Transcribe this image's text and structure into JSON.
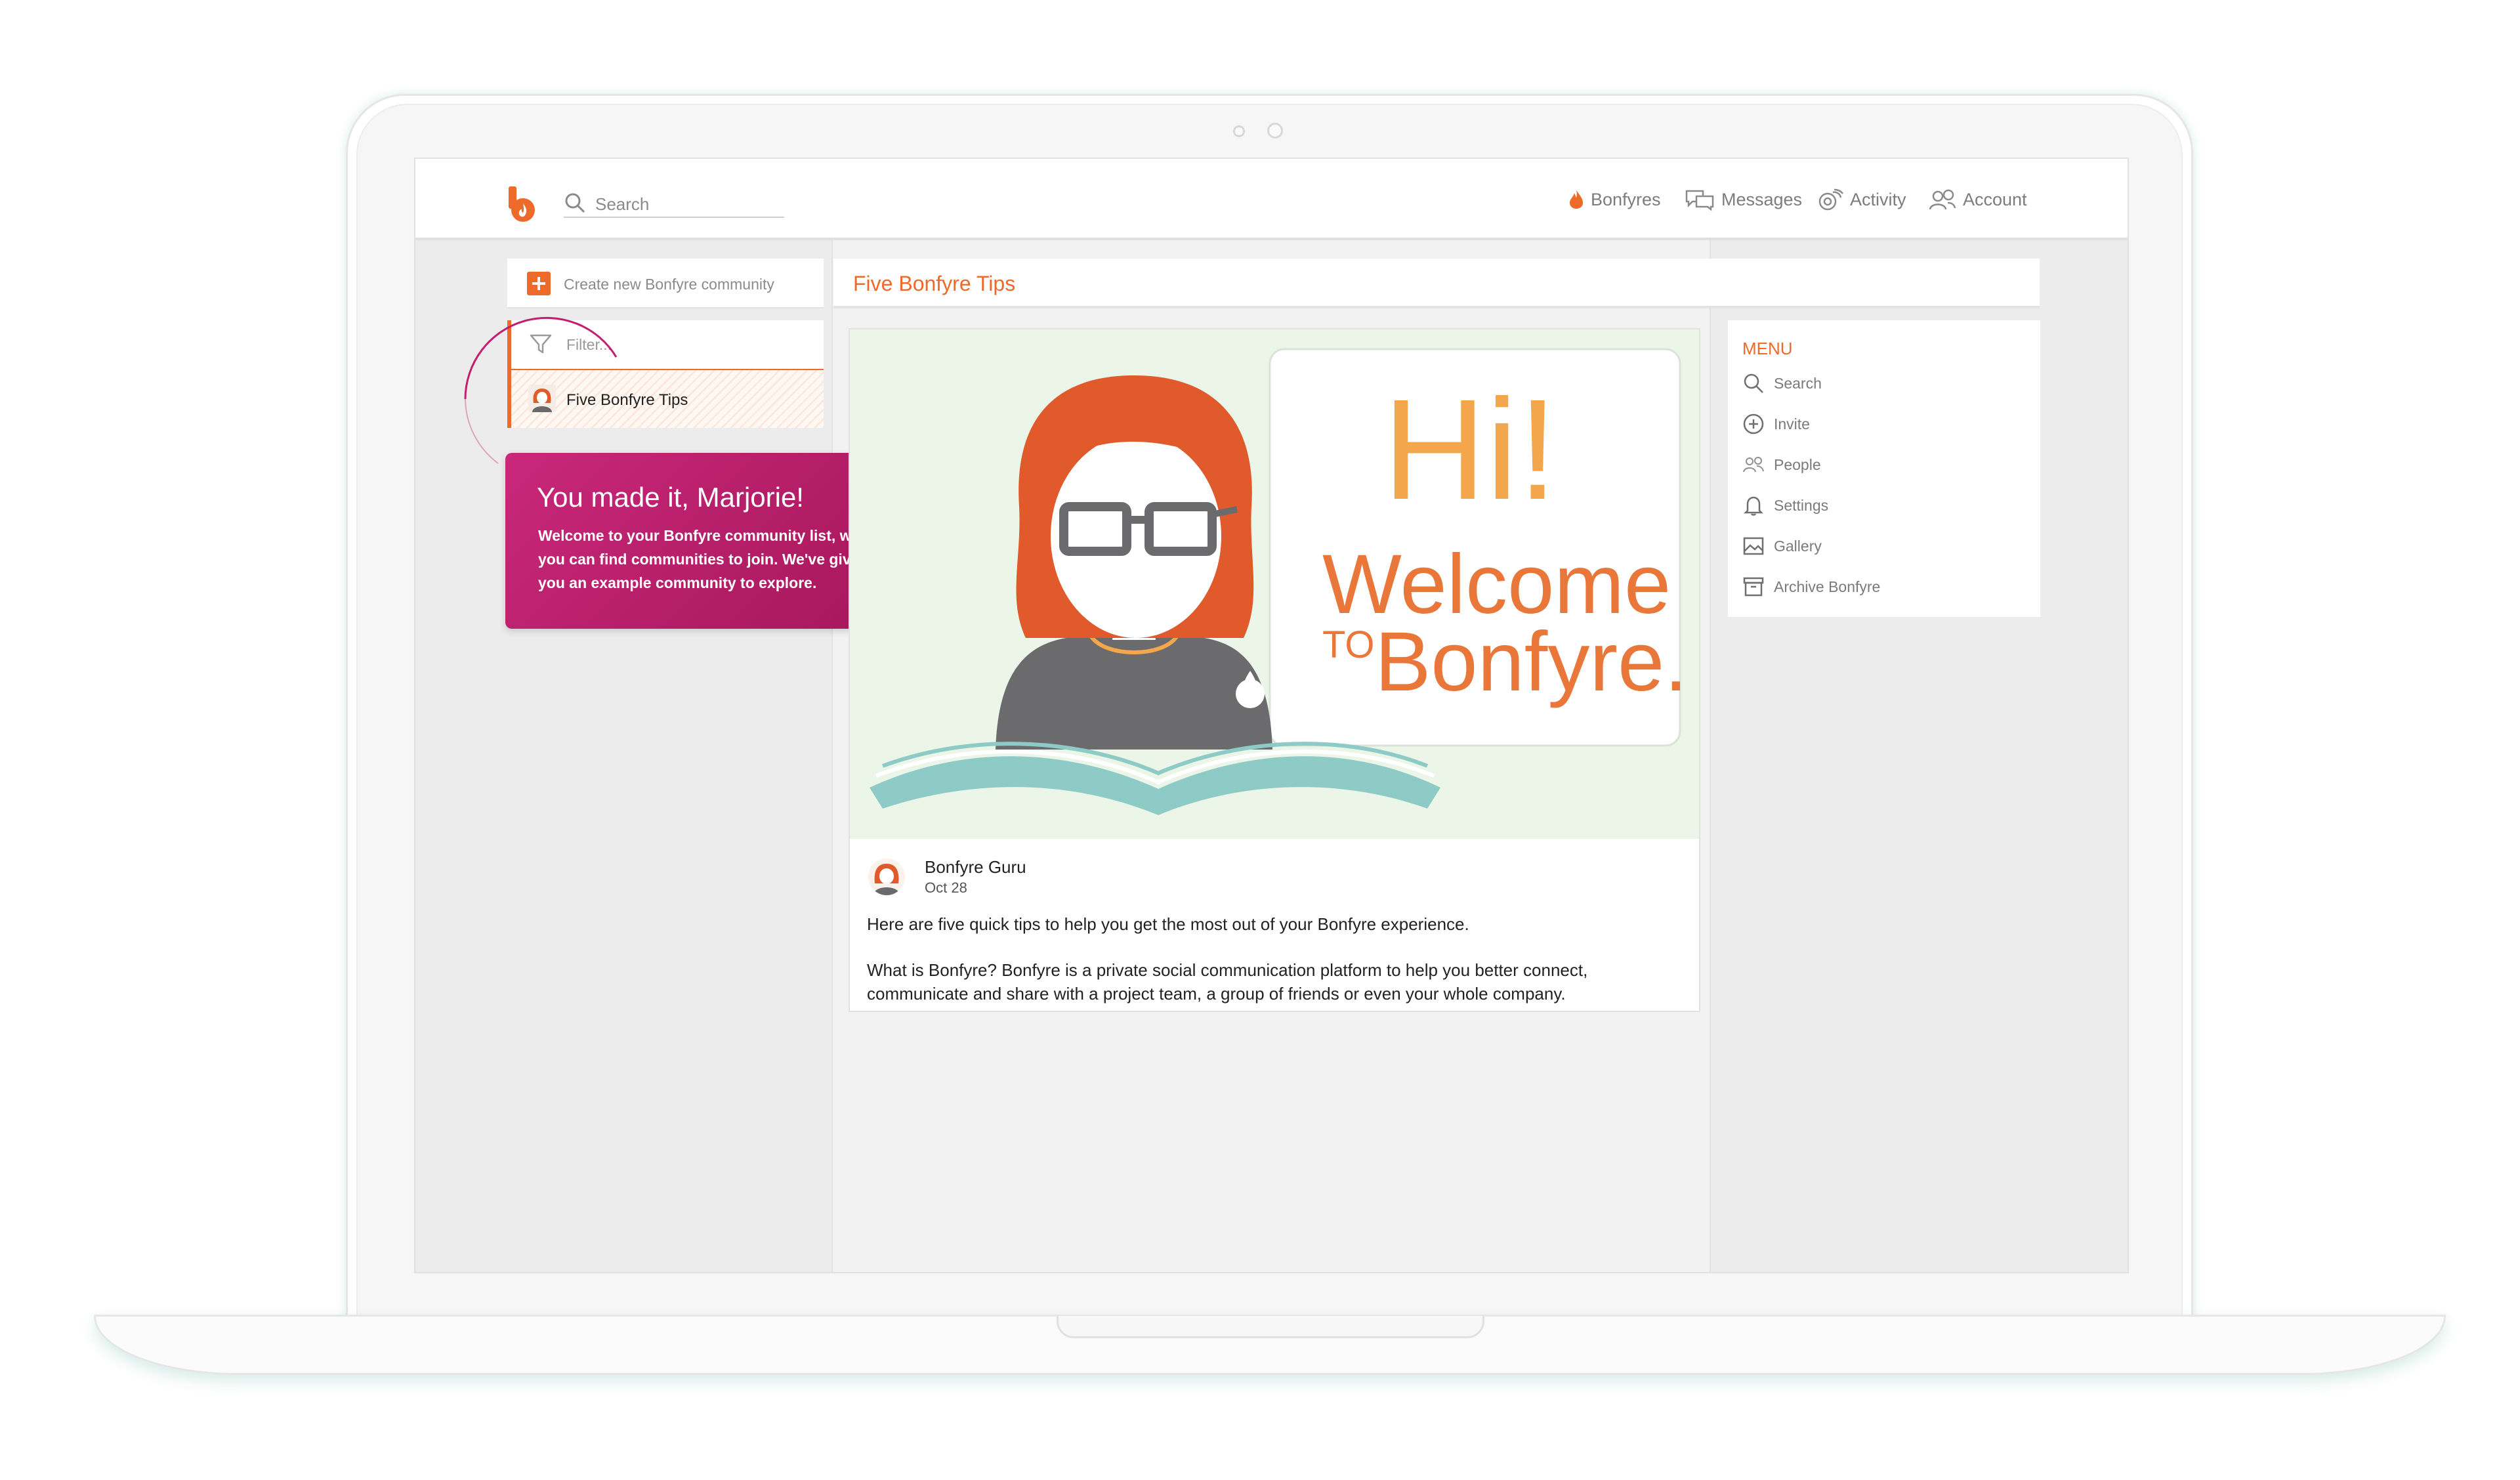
{
  "header": {
    "search_placeholder": "Search",
    "nav": [
      {
        "label": "Bonfyres",
        "icon": "flame-icon"
      },
      {
        "label": "Messages",
        "icon": "messages-icon"
      },
      {
        "label": "Activity",
        "icon": "activity-icon"
      },
      {
        "label": "Account",
        "icon": "account-icon"
      }
    ]
  },
  "sidebar": {
    "create_label": "Create new Bonfyre community",
    "filter_placeholder": "Filter...",
    "communities": [
      {
        "name": "Five Bonfyre Tips"
      }
    ]
  },
  "tooltip": {
    "title": "You made it, Marjorie!",
    "body": "Welcome to your Bonfyre community list, where you can find communities to join. We've given you an example community to explore.",
    "close": "×"
  },
  "page": {
    "title": "Five Bonfyre Tips"
  },
  "hero": {
    "line1": "Hi!",
    "line2": "Welcome",
    "line3_small": "TO",
    "line3": "Bonfyre."
  },
  "post": {
    "author": "Bonfyre Guru",
    "date": "Oct 28",
    "paragraphs": [
      "Here are five quick tips to help you get the most out of your Bonfyre experience.",
      "What is Bonfyre? Bonfyre is a private social communication platform to help you better connect, communicate and share with a project team, a group of friends or even your whole company."
    ]
  },
  "menu": {
    "title": "MENU",
    "items": [
      {
        "label": "Search",
        "icon": "search-icon"
      },
      {
        "label": "Invite",
        "icon": "invite-icon"
      },
      {
        "label": "People",
        "icon": "people-icon"
      },
      {
        "label": "Settings",
        "icon": "bell-icon"
      },
      {
        "label": "Gallery",
        "icon": "gallery-icon"
      },
      {
        "label": "Archive Bonfyre",
        "icon": "archive-icon"
      }
    ]
  },
  "colors": {
    "accent": "#ee6a2a",
    "tooltip": "#b81e6a",
    "hero_bg": "#ecf6e8"
  }
}
